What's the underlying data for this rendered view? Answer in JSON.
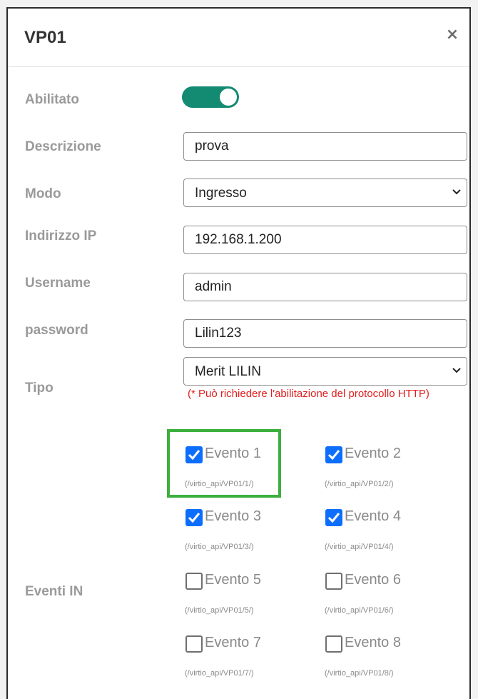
{
  "modal": {
    "title": "VP01",
    "close_label": "×"
  },
  "form": {
    "enabled_label": "Abilitato",
    "enabled": true,
    "description_label": "Descrizione",
    "description_value": "prova",
    "mode_label": "Modo",
    "mode_value": "Ingresso",
    "ip_label": "Indirizzo IP",
    "ip_value": "192.168.1.200",
    "username_label": "Username",
    "username_value": "admin",
    "password_label": "password",
    "password_value": "Lilin123",
    "type_label": "Tipo",
    "type_value": "Merit LILIN",
    "type_note": "(* Può richiedere l'abilitazione del protocollo HTTP)",
    "events_label": "Eventi IN"
  },
  "events": [
    {
      "name": "Evento 1",
      "path": "(/virtio_api/VP01/1/)",
      "checked": true
    },
    {
      "name": "Evento 2",
      "path": "(/virtio_api/VP01/2/)",
      "checked": true
    },
    {
      "name": "Evento 3",
      "path": "(/virtio_api/VP01/3/)",
      "checked": true
    },
    {
      "name": "Evento 4",
      "path": "(/virtio_api/VP01/4/)",
      "checked": true
    },
    {
      "name": "Evento 5",
      "path": "(/virtio_api/VP01/5/)",
      "checked": false
    },
    {
      "name": "Evento 6",
      "path": "(/virtio_api/VP01/6/)",
      "checked": false
    },
    {
      "name": "Evento 7",
      "path": "(/virtio_api/VP01/7/)",
      "checked": false
    },
    {
      "name": "Evento 8",
      "path": "(/virtio_api/VP01/8/)",
      "checked": false
    }
  ],
  "colors": {
    "toggle_on": "#138a72",
    "checkbox_checked": "#0d6efd",
    "note_red": "#e02020",
    "highlight_green": "#3daf3d"
  }
}
